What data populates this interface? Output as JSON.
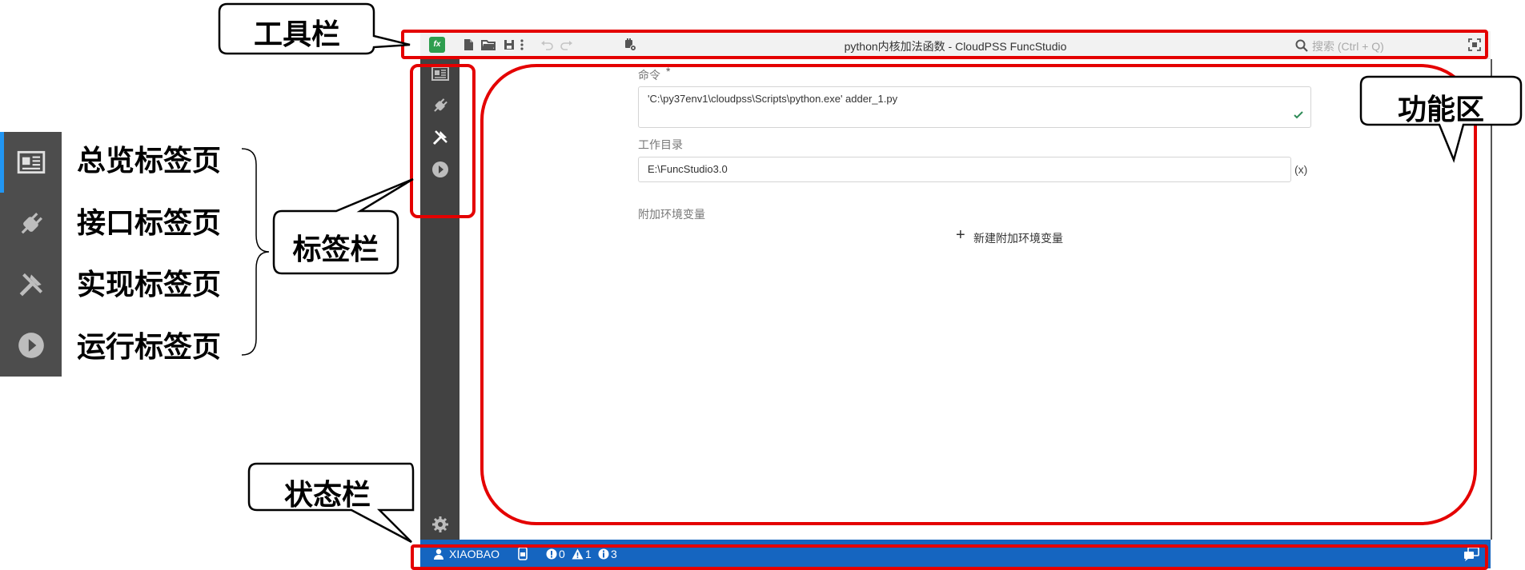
{
  "window": {
    "title": "python内核加法函数 - CloudPSS FuncStudio",
    "logo_text": "fx",
    "search_placeholder": "搜索 (Ctrl + Q)"
  },
  "form": {
    "command_label": "命令",
    "required_mark": "*",
    "command_value": "'C:\\py37env1\\cloudpss\\Scripts\\python.exe' adder_1.py",
    "workdir_label": "工作目录",
    "workdir_value": "E:\\FuncStudio3.0",
    "workdir_expr": "(x)",
    "env_label": "附加环境变量",
    "add_env_label": "新建附加环境变量"
  },
  "statusbar": {
    "user": "XIAOBAO",
    "errors": "0",
    "warnings": "1",
    "infos": "3"
  },
  "annotations": {
    "toolbar": "工具栏",
    "function_area": "功能区",
    "tab_bar": "标签栏",
    "status_bar": "状态栏",
    "tabs": [
      "总览标签页",
      "接口标签页",
      "实现标签页",
      "运行标签页"
    ]
  },
  "colors": {
    "statusbar_bg": "#1565c0",
    "sidebar_bg": "#424242",
    "annotation_red": "#e40000",
    "logo_green": "#2e9e4f"
  }
}
